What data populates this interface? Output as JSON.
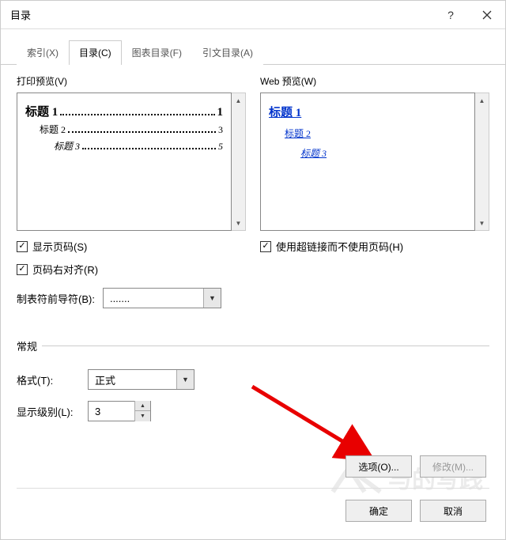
{
  "titlebar": {
    "title": "目录"
  },
  "tabs": [
    {
      "label": "索引(X)"
    },
    {
      "label": "目录(C)"
    },
    {
      "label": "图表目录(F)"
    },
    {
      "label": "引文目录(A)"
    }
  ],
  "printPreview": {
    "label": "打印预览(V)",
    "rows": [
      {
        "text": "标题 1",
        "page": "1",
        "bold": true
      },
      {
        "text": "标题 2",
        "page": "3",
        "indent": 1
      },
      {
        "text": "标题 3",
        "page": "5",
        "indent": 2,
        "italic": true
      }
    ]
  },
  "webPreview": {
    "label": "Web 预览(W)",
    "rows": [
      {
        "text": "标题 1",
        "bold": true
      },
      {
        "text": "标题 2",
        "indent": 1
      },
      {
        "text": "标题 3",
        "indent": 2,
        "italic": true
      }
    ]
  },
  "options": {
    "showPageNumbers": {
      "label": "显示页码(S)",
      "checked": true
    },
    "rightAlign": {
      "label": "页码右对齐(R)",
      "checked": true
    },
    "useHyperlinks": {
      "label": "使用超链接而不使用页码(H)",
      "checked": true
    }
  },
  "tabLeader": {
    "label": "制表符前导符(B):",
    "value": "......."
  },
  "general": {
    "sectionLabel": "常规",
    "format": {
      "label": "格式(T):",
      "value": "正式"
    },
    "showLevels": {
      "label": "显示级别(L):",
      "value": "3"
    }
  },
  "buttons": {
    "options": "选项(O)...",
    "modify": "修改(M)...",
    "ok": "确定",
    "cancel": "取消"
  }
}
